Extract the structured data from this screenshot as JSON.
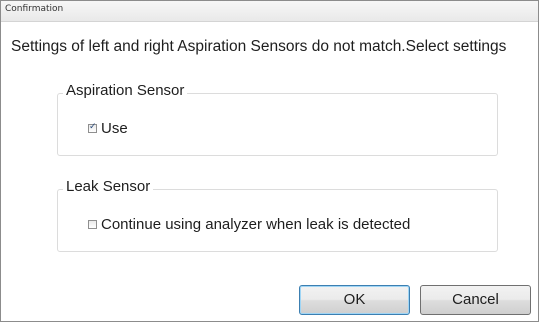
{
  "window": {
    "title": "Confirmation"
  },
  "message": "Settings of left and right Aspiration Sensors do not match.Select settings",
  "aspiration_group": {
    "legend": "Aspiration Sensor",
    "checkbox": {
      "label": "Use",
      "checked": true
    }
  },
  "leak_group": {
    "legend": "Leak Sensor",
    "checkbox": {
      "label": "Continue using analyzer when leak is detected",
      "checked": false
    }
  },
  "buttons": {
    "ok_label": "OK",
    "cancel_label": "Cancel"
  },
  "colors": {
    "default_button_border": "#3c7fb1",
    "check_mark": "#2a4a7a"
  },
  "icons": {
    "checked": "check-icon"
  }
}
